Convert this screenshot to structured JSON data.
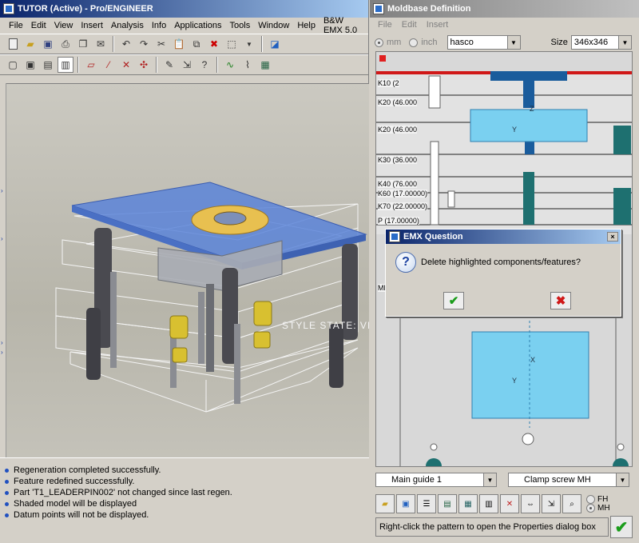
{
  "proe": {
    "title": "TUTOR (Active) - Pro/ENGINEER",
    "menu": [
      "File",
      "Edit",
      "View",
      "Insert",
      "Analysis",
      "Info",
      "Applications",
      "Tools",
      "Window",
      "Help",
      "B&W EMX 5.0"
    ],
    "viewport_watermark": "STYLE STATE: VIS",
    "messages": [
      "Regeneration completed successfully.",
      "Feature redefined successfully.",
      "Part 'T1_LEADERPIN002' not changed since last regen.",
      "Shaded model will be displayed",
      "Datum points will not be displayed."
    ]
  },
  "moldbase": {
    "title": "Moldbase Definition",
    "menu": [
      "File",
      "Edit",
      "Insert"
    ],
    "unit_mm": "mm",
    "unit_inch": "inch",
    "unit_selected": "mm",
    "vendor": "hasco",
    "size_label": "Size",
    "size_value": "346x346",
    "plates": [
      "K10 (2",
      "K20 (46.000",
      "K20 (46.000",
      "K30 (36.000",
      "K40 (76.000",
      "K60 (17.00000)",
      "K70 (22.00000)",
      "P (17.00000)"
    ],
    "side_labels": [
      "MH"
    ],
    "axis_y": "Y",
    "axis_x": "X",
    "axis_z": "Z",
    "guide_combo": "Main guide 1",
    "screw_combo": "Clamp screw MH",
    "fh_label": "FH",
    "mh_label": "MH",
    "status": "Right-click the pattern to open the Properties dialog box"
  },
  "dialog": {
    "title": "EMX Question",
    "text": "Delete highlighted components/features?",
    "close": "×",
    "ok": "✔",
    "cancel": "✖"
  }
}
